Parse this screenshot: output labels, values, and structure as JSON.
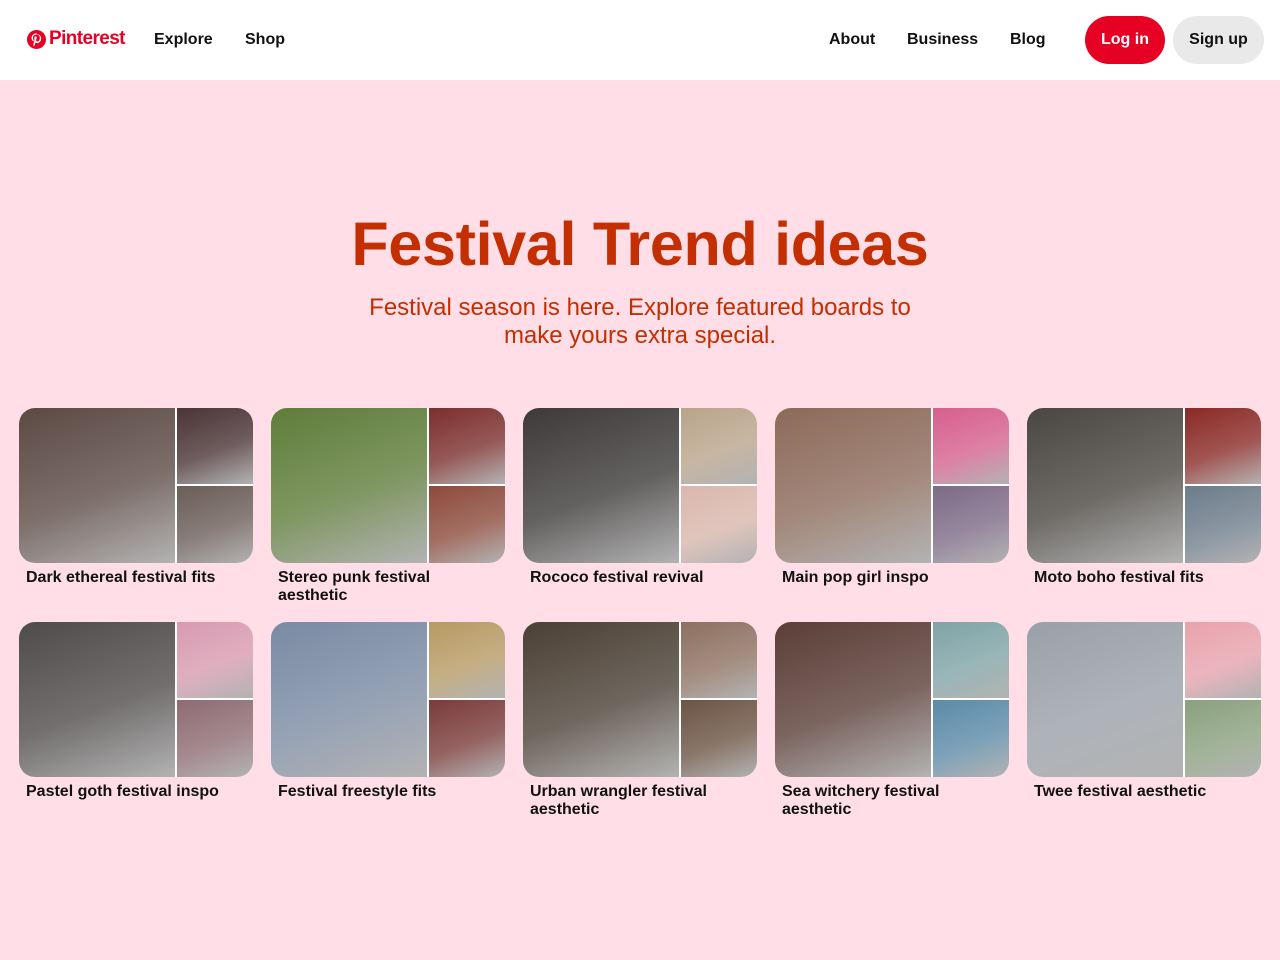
{
  "header": {
    "logo_text": "Pinterest",
    "logo_icon": "pinterest-logo-icon",
    "nav_left": [
      "Explore",
      "Shop"
    ],
    "nav_right": [
      "About",
      "Business",
      "Blog"
    ],
    "login_label": "Log in",
    "signup_label": "Sign up",
    "brand_color": "#e60023"
  },
  "hero": {
    "title": "Festival Trend ideas",
    "subtitle": "Festival season is here. Explore featured boards to make yours extra special.",
    "text_color": "#c32f00",
    "background_color": "#ffdee8"
  },
  "boards": [
    {
      "title": "Dark ethereal festival fits",
      "colors": [
        "#5c4a44",
        "#4a3436",
        "#6b5d58"
      ]
    },
    {
      "title": "Stereo punk festival aesthetic",
      "colors": [
        "#5f7d3a",
        "#7b2f2d",
        "#8d4a3c"
      ]
    },
    {
      "title": "Rococo festival revival",
      "colors": [
        "#3d3a39",
        "#b9a48a",
        "#d9b7ad"
      ]
    },
    {
      "title": "Main pop girl inspo",
      "colors": [
        "#8c6a5a",
        "#d65f8d",
        "#7d6a86"
      ]
    },
    {
      "title": "Moto boho festival fits",
      "colors": [
        "#4a4641",
        "#8a2a26",
        "#6d7c8a"
      ]
    },
    {
      "title": "Pastel goth festival inspo",
      "colors": [
        "#4f4b4a",
        "#d89ab0",
        "#8e6b73"
      ]
    },
    {
      "title": "Festival freestyle fits",
      "colors": [
        "#7a8aa3",
        "#b79a63",
        "#7a3b3a"
      ]
    },
    {
      "title": "Urban wrangler festival aesthetic",
      "colors": [
        "#4b4035",
        "#8d7060",
        "#6c5444"
      ]
    },
    {
      "title": "Sea witchery festival aesthetic",
      "colors": [
        "#5b3e37",
        "#7fa3a6",
        "#5b8aa8"
      ]
    },
    {
      "title": "Twee festival aesthetic",
      "colors": [
        "#9aa0a8",
        "#e8a2ac",
        "#8aa07e"
      ]
    }
  ]
}
